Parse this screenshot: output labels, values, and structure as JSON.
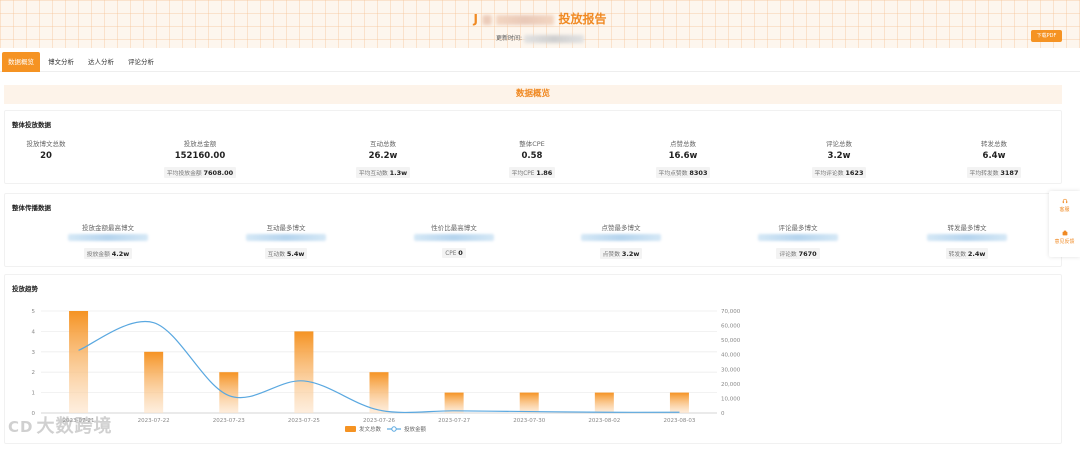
{
  "header": {
    "title_prefix": "J",
    "title_suffix": "投放报告",
    "update_label": "更新时间:",
    "pdf_button": "下载PDF"
  },
  "tabs": [
    {
      "label": "数据概览",
      "active": true
    },
    {
      "label": "博文分析",
      "active": false
    },
    {
      "label": "达人分析",
      "active": false
    },
    {
      "label": "评论分析",
      "active": false
    }
  ],
  "section_title": "数据概览",
  "overall": {
    "title": "整体投放数据",
    "stats": [
      {
        "label": "投放博文总数",
        "value": "20",
        "avg_label": "",
        "avg_value": ""
      },
      {
        "label": "投放总金额",
        "value": "152160.00",
        "avg_label": "平均投放金额",
        "avg_value": "7608.00"
      },
      {
        "label": "互动总数",
        "value": "26.2w",
        "avg_label": "平均互动数",
        "avg_value": "1.3w"
      },
      {
        "label": "整体CPE",
        "value": "0.58",
        "avg_label": "平均CPE",
        "avg_value": "1.86"
      },
      {
        "label": "点赞总数",
        "value": "16.6w",
        "avg_label": "平均点赞数",
        "avg_value": "8303"
      },
      {
        "label": "评论总数",
        "value": "3.2w",
        "avg_label": "平均评论数",
        "avg_value": "1623"
      },
      {
        "label": "转发总数",
        "value": "6.4w",
        "avg_label": "平均转发数",
        "avg_value": "3187"
      }
    ]
  },
  "spread": {
    "title": "整体传播数据",
    "items": [
      {
        "label": "投放金额最高博文",
        "metric_label": "投放金额",
        "metric_value": "4.2w"
      },
      {
        "label": "互动最多博文",
        "metric_label": "互动数",
        "metric_value": "5.4w"
      },
      {
        "label": "性价比最高博文",
        "metric_label": "CPE",
        "metric_value": "0"
      },
      {
        "label": "点赞最多博文",
        "metric_label": "点赞数",
        "metric_value": "3.2w"
      },
      {
        "label": "评论最多博文",
        "metric_label": "评论数",
        "metric_value": "7670"
      },
      {
        "label": "转发最多博文",
        "metric_label": "转发数",
        "metric_value": "2.4w"
      }
    ]
  },
  "sidebar": {
    "items": [
      {
        "label": "客服",
        "icon": "headset-icon"
      },
      {
        "label": "意见反馈",
        "icon": "feedback-icon"
      }
    ]
  },
  "trend": {
    "title": "投放趋势"
  },
  "chart_data": {
    "type": "bar",
    "categories": [
      "2023-07-21",
      "2023-07-22",
      "2023-07-23",
      "2023-07-25",
      "2023-07-26",
      "2023-07-27",
      "2023-07-30",
      "2023-08-02",
      "2023-08-03"
    ],
    "series": [
      {
        "name": "发文总数",
        "type": "bar",
        "axis": "left",
        "color": "#f59323",
        "values": [
          5,
          3,
          2,
          4,
          2,
          1,
          1,
          1,
          1
        ]
      },
      {
        "name": "投放金额",
        "type": "line",
        "axis": "right",
        "color": "#5aa8e0",
        "values": [
          43000,
          62000,
          12000,
          22000,
          2000,
          1500,
          1000,
          500,
          500
        ]
      }
    ],
    "y_left": {
      "min": 0,
      "max": 5,
      "ticks": [
        0,
        1,
        2,
        3,
        4,
        5
      ]
    },
    "y_right": {
      "min": 0,
      "max": 70000,
      "ticks": [
        "0",
        "10,000",
        "20,000",
        "30,000",
        "40,000",
        "50,000",
        "60,000",
        "70,000"
      ]
    },
    "grid": true,
    "legend": "bottom"
  },
  "watermark": {
    "icon": "CD",
    "text": "大数跨境"
  }
}
